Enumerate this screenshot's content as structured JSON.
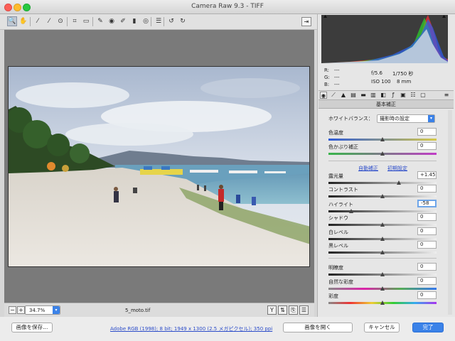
{
  "window": {
    "title": "Camera Raw 9.3  -  TIFF"
  },
  "toolbar": {
    "tools": [
      {
        "name": "zoom-tool-icon",
        "glyph": "🔍",
        "selected": true
      },
      {
        "name": "hand-tool-icon",
        "glyph": "✋"
      },
      {
        "name": "white-balance-tool-icon",
        "glyph": "⁄"
      },
      {
        "name": "color-sampler-tool-icon",
        "glyph": "⁄"
      },
      {
        "name": "targeted-adjustment-tool-icon",
        "glyph": "⊙"
      },
      {
        "name": "crop-tool-icon",
        "glyph": "⌗"
      },
      {
        "name": "straighten-tool-icon",
        "glyph": "▭"
      },
      {
        "name": "spot-removal-tool-icon",
        "glyph": "✎"
      },
      {
        "name": "red-eye-tool-icon",
        "glyph": "◉"
      },
      {
        "name": "adjustment-brush-icon",
        "glyph": "✐"
      },
      {
        "name": "graduated-filter-icon",
        "glyph": "▮"
      },
      {
        "name": "radial-filter-icon",
        "glyph": "◎"
      },
      {
        "name": "preferences-icon",
        "glyph": "☰"
      },
      {
        "name": "rotate-ccw-icon",
        "glyph": "↺"
      },
      {
        "name": "rotate-cw-icon",
        "glyph": "↻"
      }
    ]
  },
  "preview": {
    "zoom": "34.7%",
    "filename": "5_moto.tif"
  },
  "histogram": {
    "r_label": "R:",
    "g_label": "G:",
    "b_label": "B:",
    "r_value": "---",
    "g_value": "---",
    "b_value": "---",
    "aperture": "f/5.6",
    "shutter": "1/750 秒",
    "iso": "ISO 100",
    "focal": "8 mm"
  },
  "panel": {
    "title": "基本補正",
    "wb_label": "ホワイトバランス：",
    "wb_value": "撮影時の設定",
    "auto_label": "自動補正",
    "default_label": "初期設定",
    "sliders": [
      {
        "label": "色温度",
        "value": "0",
        "pos": 0.5,
        "gradient": "linear-gradient(90deg,#2e5bd8,#d6c94a)"
      },
      {
        "label": "色かぶり補正",
        "value": "0",
        "pos": 0.5,
        "gradient": "linear-gradient(90deg,#38b54a,#c13cc7)"
      },
      {
        "label": "露光量",
        "value": "+1.45",
        "pos": 0.65,
        "gradient": "linear-gradient(90deg,#222,#eee)"
      },
      {
        "label": "コントラスト",
        "value": "0",
        "pos": 0.5,
        "gradient": "linear-gradient(90deg,#222,#eee)"
      },
      {
        "label": "ハイライト",
        "value": "-58",
        "pos": 0.21,
        "gradient": "linear-gradient(90deg,#222,#eee)",
        "active": true
      },
      {
        "label": "シャドウ",
        "value": "0",
        "pos": 0.5,
        "gradient": "linear-gradient(90deg,#222,#eee)"
      },
      {
        "label": "白レベル",
        "value": "0",
        "pos": 0.5,
        "gradient": "linear-gradient(90deg,#222,#eee)"
      },
      {
        "label": "黒レベル",
        "value": "0",
        "pos": 0.5,
        "gradient": "linear-gradient(90deg,#222,#eee)"
      },
      {
        "label": "明瞭度",
        "value": "0",
        "pos": 0.5,
        "gradient": "linear-gradient(90deg,#222,#eee)"
      },
      {
        "label": "自然な彩度",
        "value": "0",
        "pos": 0.5,
        "gradient": "linear-gradient(90deg,#888,#d2a,#5a5,#37e)"
      },
      {
        "label": "彩度",
        "value": "0",
        "pos": 0.5,
        "gradient": "linear-gradient(90deg,#888,#e33,#ec3,#3c3,#3ae,#a3e)"
      }
    ]
  },
  "footer": {
    "save_label": "画像を保存...",
    "workflow_link": "Adobe RGB (1998); 8 bit; 1949 x 1300 (2.5 メガピクセル); 350 ppi",
    "open_label": "画像を開く",
    "cancel_label": "キャンセル",
    "done_label": "完了"
  }
}
